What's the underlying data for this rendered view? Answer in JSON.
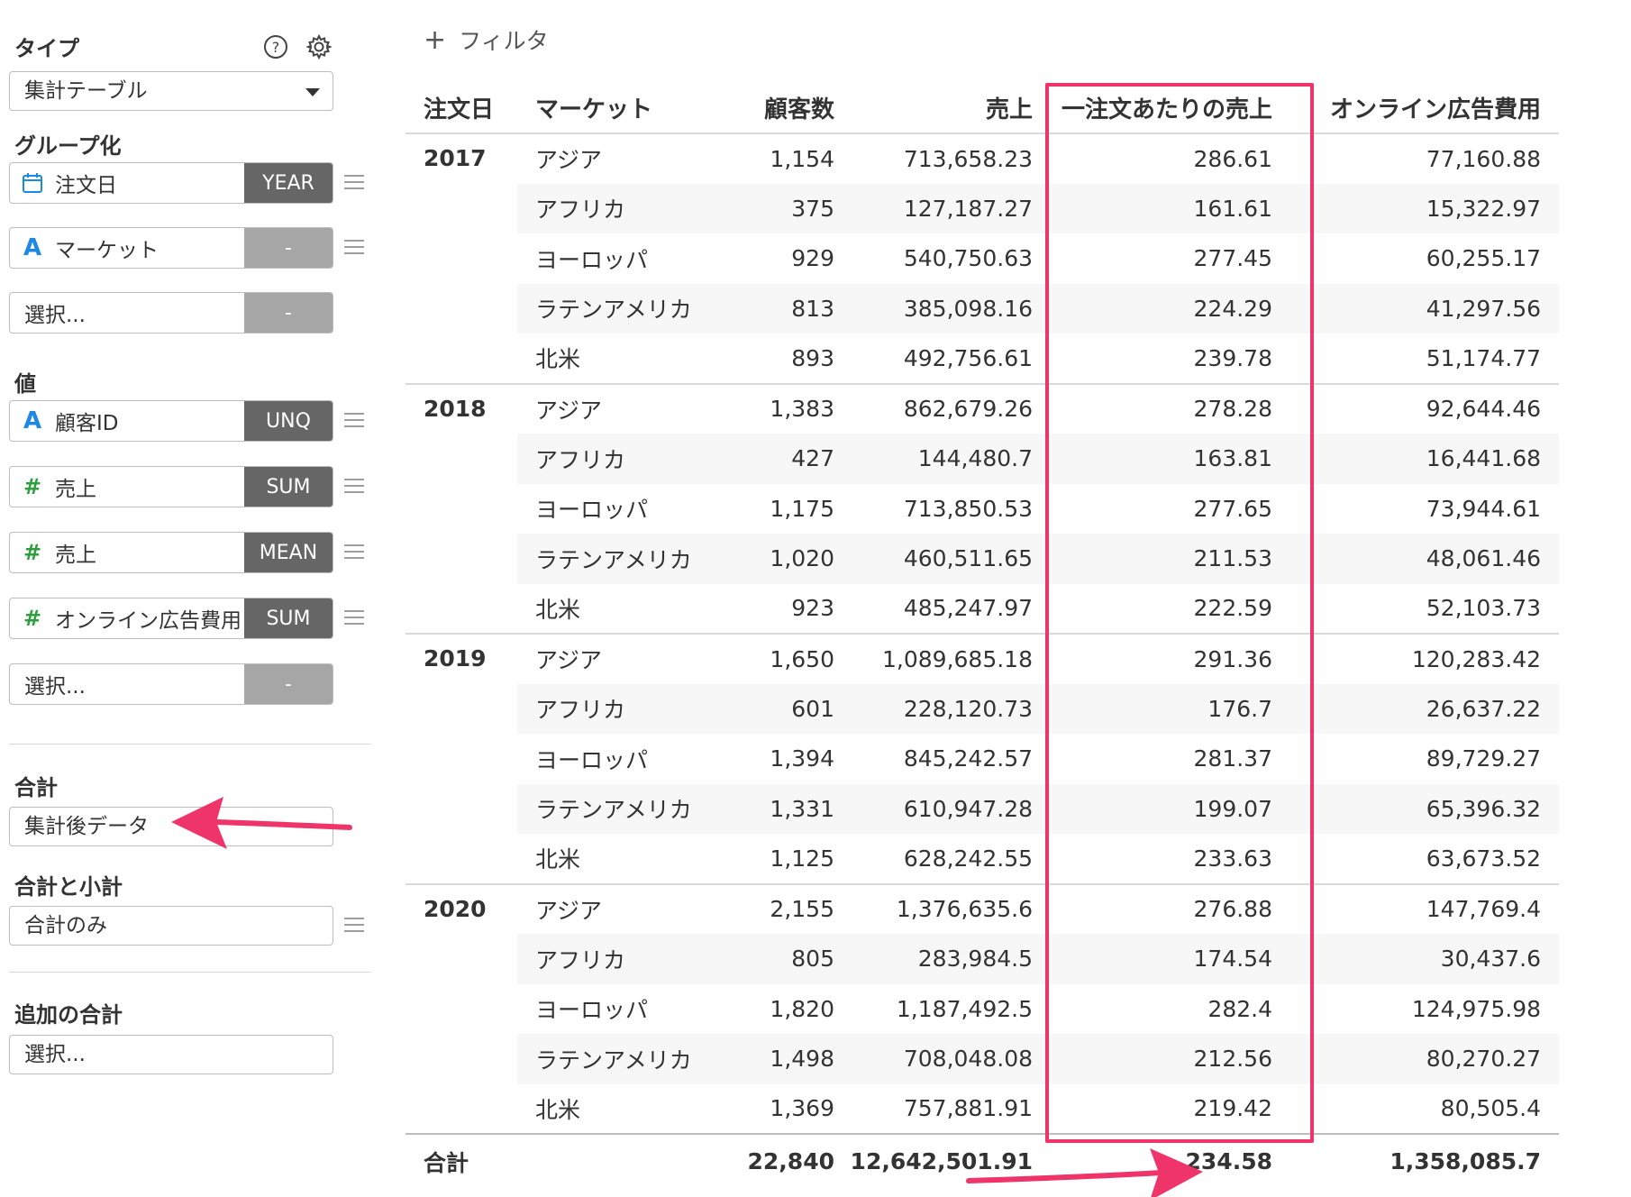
{
  "sidebar": {
    "type_label": "タイプ",
    "type_value": "集計テーブル",
    "group_label": "グループ化",
    "groups": [
      {
        "label": "注文日",
        "icon": "calendar-icon",
        "agg": "YEAR"
      },
      {
        "label": "マーケット",
        "icon": "string-icon",
        "agg": "-"
      },
      {
        "label": "選択...",
        "icon": "",
        "agg": "-"
      }
    ],
    "value_label": "値",
    "values": [
      {
        "label": "顧客ID",
        "icon": "string-icon",
        "agg": "UNQ"
      },
      {
        "label": "売上",
        "icon": "number-icon",
        "agg": "SUM"
      },
      {
        "label": "売上",
        "icon": "number-icon",
        "agg": "MEAN"
      },
      {
        "label": "オンライン広告費用",
        "icon": "number-icon",
        "agg": "SUM"
      },
      {
        "label": "選択...",
        "icon": "",
        "agg": "-"
      }
    ],
    "total_label": "合計",
    "total_value": "集計後データ",
    "subtotal_label": "合計と小計",
    "subtotal_value": "合計のみ",
    "extra_total_label": "追加の合計",
    "extra_total_value": "選択..."
  },
  "filter": {
    "label": "フィルタ"
  },
  "table": {
    "headers": [
      "注文日",
      "マーケット",
      "顧客数",
      "売上",
      "一注文あたりの売上",
      "オンライン広告費用"
    ],
    "groups": [
      {
        "year": "2017",
        "rows": [
          [
            "アジア",
            "1,154",
            "713,658.23",
            "286.61",
            "77,160.88"
          ],
          [
            "アフリカ",
            "375",
            "127,187.27",
            "161.61",
            "15,322.97"
          ],
          [
            "ヨーロッパ",
            "929",
            "540,750.63",
            "277.45",
            "60,255.17"
          ],
          [
            "ラテンアメリカ",
            "813",
            "385,098.16",
            "224.29",
            "41,297.56"
          ],
          [
            "北米",
            "893",
            "492,756.61",
            "239.78",
            "51,174.77"
          ]
        ]
      },
      {
        "year": "2018",
        "rows": [
          [
            "アジア",
            "1,383",
            "862,679.26",
            "278.28",
            "92,644.46"
          ],
          [
            "アフリカ",
            "427",
            "144,480.7",
            "163.81",
            "16,441.68"
          ],
          [
            "ヨーロッパ",
            "1,175",
            "713,850.53",
            "277.65",
            "73,944.61"
          ],
          [
            "ラテンアメリカ",
            "1,020",
            "460,511.65",
            "211.53",
            "48,061.46"
          ],
          [
            "北米",
            "923",
            "485,247.97",
            "222.59",
            "52,103.73"
          ]
        ]
      },
      {
        "year": "2019",
        "rows": [
          [
            "アジア",
            "1,650",
            "1,089,685.18",
            "291.36",
            "120,283.42"
          ],
          [
            "アフリカ",
            "601",
            "228,120.73",
            "176.7",
            "26,637.22"
          ],
          [
            "ヨーロッパ",
            "1,394",
            "845,242.57",
            "281.37",
            "89,729.27"
          ],
          [
            "ラテンアメリカ",
            "1,331",
            "610,947.28",
            "199.07",
            "65,396.32"
          ],
          [
            "北米",
            "1,125",
            "628,242.55",
            "233.63",
            "63,673.52"
          ]
        ]
      },
      {
        "year": "2020",
        "rows": [
          [
            "アジア",
            "2,155",
            "1,376,635.6",
            "276.88",
            "147,769.4"
          ],
          [
            "アフリカ",
            "805",
            "283,984.5",
            "174.54",
            "30,437.6"
          ],
          [
            "ヨーロッパ",
            "1,820",
            "1,187,492.5",
            "282.4",
            "124,975.98"
          ],
          [
            "ラテンアメリカ",
            "1,498",
            "708,048.08",
            "212.56",
            "80,270.27"
          ],
          [
            "北米",
            "1,369",
            "757,881.91",
            "219.42",
            "80,505.4"
          ]
        ]
      }
    ],
    "total": {
      "label": "合計",
      "values": [
        "",
        "22,840",
        "12,642,501.91",
        "234.58",
        "1,358,085.7"
      ]
    }
  },
  "colors": {
    "accent": "#ee3469",
    "agg_dark": "#666666",
    "agg_empty": "#a6a6a6",
    "string_icon": "#1e88e5",
    "number_icon": "#2e9e3f"
  }
}
